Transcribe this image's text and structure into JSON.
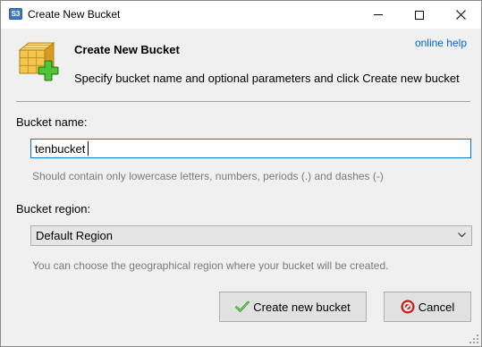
{
  "window": {
    "title": "Create New Bucket",
    "icon_text": "S3"
  },
  "header": {
    "title": "Create New Bucket",
    "description": "Specify bucket name and optional parameters and click Create new bucket",
    "online_help": "online help",
    "icon": "bucket-add-icon"
  },
  "bucket_name": {
    "label": "Bucket name:",
    "value": "tenbucket",
    "hint": "Should contain only lowercase letters, numbers, periods (.) and dashes (-)"
  },
  "bucket_region": {
    "label": "Bucket region:",
    "selected": "Default Region",
    "hint": "You can choose the geographical region where your bucket will be created."
  },
  "buttons": {
    "create": "Create new bucket",
    "cancel": "Cancel"
  },
  "colors": {
    "link": "#0066cc",
    "focus_border": "#0078d7",
    "hint_text": "#7a7a7a"
  }
}
